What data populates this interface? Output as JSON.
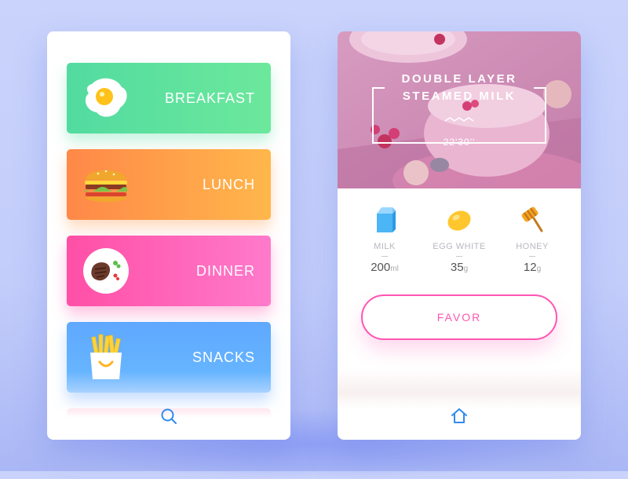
{
  "colors": {
    "accent_pink": "#ff55b2",
    "accent_blue": "#2f8cf0"
  },
  "menu": {
    "items": [
      {
        "label": "BREAKFAST",
        "icon": "fried-egg-icon"
      },
      {
        "label": "LUNCH",
        "icon": "burger-icon"
      },
      {
        "label": "DINNER",
        "icon": "steak-plate-icon"
      },
      {
        "label": "SNACKS",
        "icon": "fries-icon"
      }
    ],
    "bottom_icon": "search-icon"
  },
  "detail": {
    "title_line1": "DOUBLE LAYER",
    "title_line2": "STEAMED MILK",
    "time": "22'30''",
    "ingredients": [
      {
        "name": "MILK",
        "amount": "200",
        "unit": "ml",
        "icon": "milk-carton-icon"
      },
      {
        "name": "EGG WHITE",
        "amount": "35",
        "unit": "g",
        "icon": "egg-icon"
      },
      {
        "name": "HONEY",
        "amount": "12",
        "unit": "g",
        "icon": "honey-dipper-icon"
      }
    ],
    "favor_label": "FAVOR",
    "bottom_icon": "home-icon"
  }
}
